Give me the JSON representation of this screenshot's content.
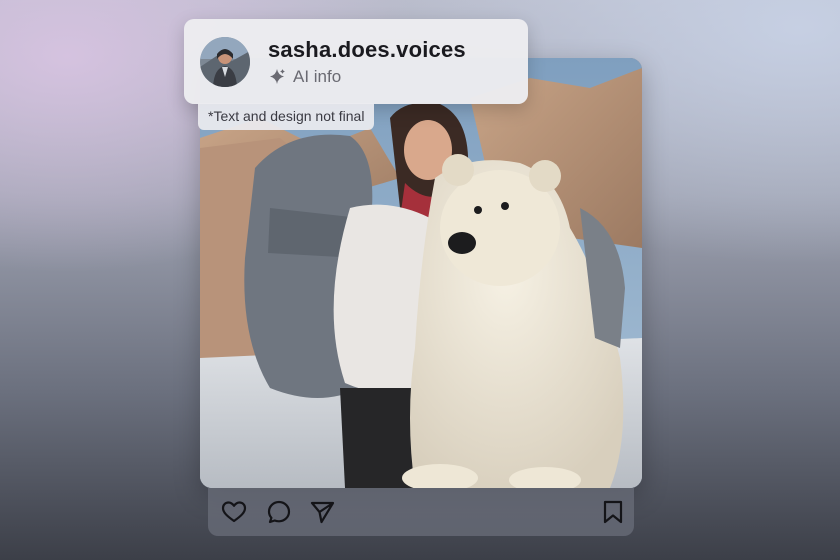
{
  "post": {
    "username": "sasha.does.voices",
    "ai_label": "AI info",
    "disclaimer": "*Text and design not final"
  },
  "icons": {
    "ai": "sparkle-icon",
    "actions": [
      "heart-icon",
      "comment-icon",
      "share-icon",
      "bookmark-icon"
    ]
  },
  "colors": {
    "header_bg": "#ececf0",
    "username_text": "#1a1a1f",
    "ai_text": "#6a6a72",
    "action_bar": "#696e7a"
  }
}
